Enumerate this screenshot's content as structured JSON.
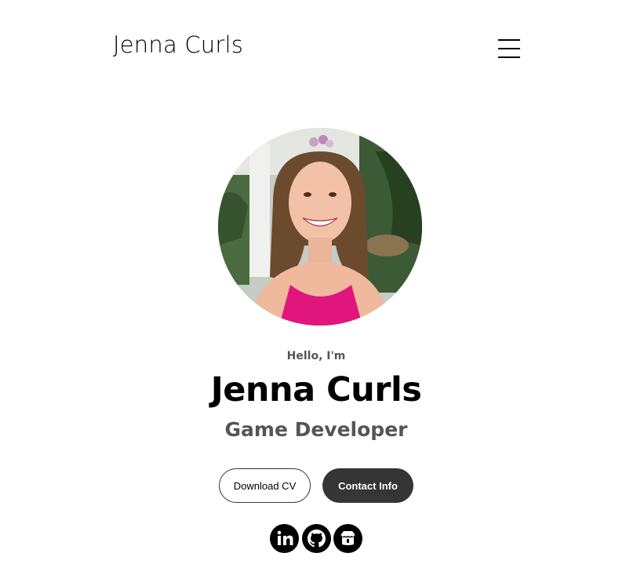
{
  "header": {
    "logo_text": "Jenna Curls",
    "menu_icon": "hamburger-menu-icon"
  },
  "hero": {
    "profile_image": "profile-photo",
    "greeting": "Hello, I'm",
    "name": "Jenna Curls",
    "role": "Game Developer",
    "buttons": {
      "download_cv": "Download CV",
      "contact_info": "Contact Info"
    },
    "social_icons": [
      "linkedin-icon",
      "github-icon",
      "itch-io-icon"
    ]
  },
  "colors": {
    "text": "#000000",
    "muted": "#555555",
    "button_dark": "#353535",
    "background": "#ffffff"
  }
}
